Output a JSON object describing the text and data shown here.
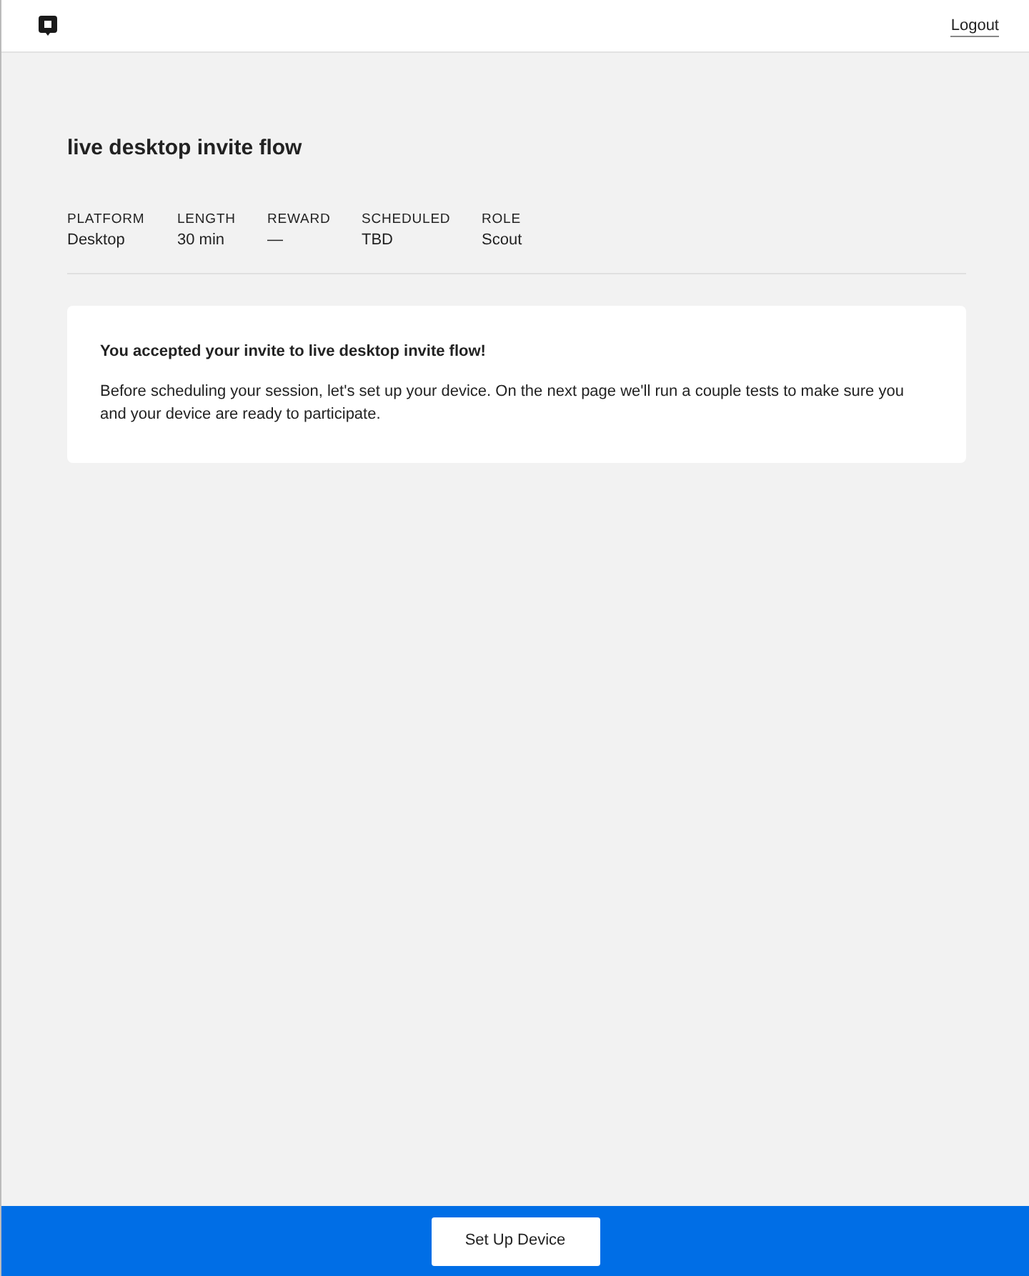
{
  "header": {
    "logout": "Logout"
  },
  "study": {
    "title": "live desktop invite flow",
    "details": [
      {
        "label": "PLATFORM",
        "value": "Desktop"
      },
      {
        "label": "LENGTH",
        "value": "30 min"
      },
      {
        "label": "REWARD",
        "value": "—"
      },
      {
        "label": "SCHEDULED",
        "value": "TBD"
      },
      {
        "label": "ROLE",
        "value": "Scout"
      }
    ]
  },
  "notice": {
    "heading": "You accepted your invite to live desktop invite flow!",
    "body": "Before scheduling your session, let's set up your device. On the next page we'll run a couple tests to make sure you and your device are ready to participate."
  },
  "footer": {
    "button": "Set Up Device"
  }
}
